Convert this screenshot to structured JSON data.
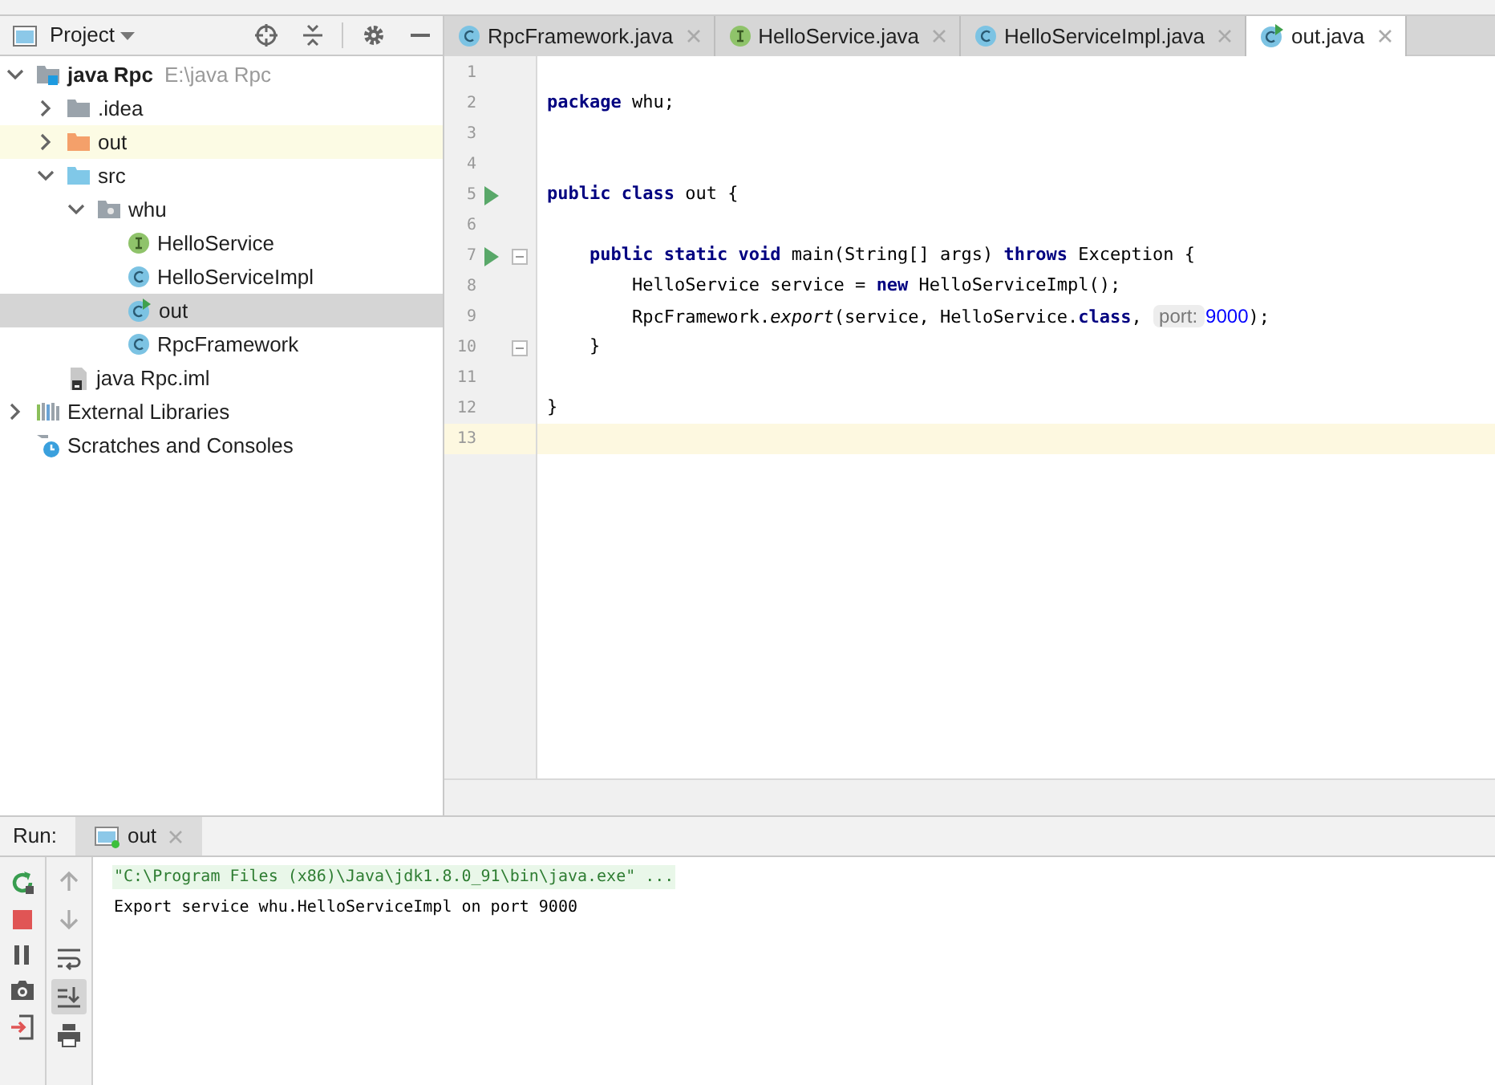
{
  "project_header": {
    "title": "Project"
  },
  "tree": [
    {
      "kind": "module",
      "label": "java Rpc",
      "path": "E:\\java Rpc",
      "expanded": true,
      "selected": false,
      "children": [
        {
          "kind": "folder",
          "label": ".idea",
          "expanded": false,
          "selected": false
        },
        {
          "kind": "excluded-folder",
          "label": "out",
          "expanded": false,
          "selected": false
        },
        {
          "kind": "source-folder",
          "label": "src",
          "expanded": true,
          "selected": false,
          "children": [
            {
              "kind": "package",
              "label": "whu",
              "expanded": true,
              "selected": false,
              "children": [
                {
                  "kind": "interface",
                  "label": "HelloService",
                  "selected": false
                },
                {
                  "kind": "class",
                  "label": "HelloServiceImpl",
                  "selected": false
                },
                {
                  "kind": "main-class",
                  "label": "out",
                  "selected": true
                },
                {
                  "kind": "class",
                  "label": "RpcFramework",
                  "selected": false
                }
              ]
            }
          ]
        },
        {
          "kind": "iml",
          "label": "java Rpc.iml",
          "selected": false
        }
      ]
    },
    {
      "kind": "libraries",
      "label": "External Libraries",
      "expanded": false,
      "selected": false
    },
    {
      "kind": "scratches",
      "label": "Scratches and Consoles",
      "selected": false
    }
  ],
  "editor_tabs": [
    {
      "kind": "class",
      "label": "RpcFramework.java",
      "selected": false
    },
    {
      "kind": "interface",
      "label": "HelloService.java",
      "selected": false
    },
    {
      "kind": "class",
      "label": "HelloServiceImpl.java",
      "selected": false
    },
    {
      "kind": "main-class",
      "label": "out.java",
      "selected": true
    }
  ],
  "code_lines": [
    {
      "number": "1",
      "current": false
    },
    {
      "number": "2",
      "current": false,
      "tokens": [
        {
          "kind": "kw",
          "t": "package"
        },
        {
          "kind": "plain",
          "t": " whu;"
        }
      ]
    },
    {
      "number": "3",
      "current": false
    },
    {
      "number": "4",
      "current": false
    },
    {
      "number": "5",
      "current": false,
      "run": true,
      "tokens": [
        {
          "kind": "kw",
          "t": "public class"
        },
        {
          "kind": "plain",
          "t": " out {"
        }
      ]
    },
    {
      "number": "6",
      "current": false
    },
    {
      "number": "7",
      "current": false,
      "run": true,
      "fold": true,
      "tokens": [
        {
          "kind": "kw",
          "t": "    public static void"
        },
        {
          "kind": "plain",
          "t": " main(String[] args) "
        },
        {
          "kind": "kw",
          "t": "throws"
        },
        {
          "kind": "plain",
          "t": " Exception {"
        }
      ]
    },
    {
      "number": "8",
      "current": false,
      "tokens": [
        {
          "kind": "plain",
          "t": "        HelloService service = "
        },
        {
          "kind": "kw",
          "t": "new"
        },
        {
          "kind": "plain",
          "t": " HelloServiceImpl();"
        }
      ]
    },
    {
      "number": "9",
      "current": false,
      "tokens": [
        {
          "kind": "plain",
          "t": "        RpcFramework."
        },
        {
          "kind": "italic",
          "t": "export"
        },
        {
          "kind": "plain",
          "t": "(service, HelloService."
        },
        {
          "kind": "kw",
          "t": "class"
        },
        {
          "kind": "plain",
          "t": ", "
        },
        {
          "kind": "hint",
          "t": "port:"
        },
        {
          "kind": "number",
          "t": "9000"
        },
        {
          "kind": "plain",
          "t": ");"
        }
      ]
    },
    {
      "number": "10",
      "current": false,
      "fold": true,
      "tokens": [
        {
          "kind": "plain",
          "t": "    }"
        }
      ]
    },
    {
      "number": "11",
      "current": false
    },
    {
      "number": "12",
      "current": false,
      "tokens": [
        {
          "kind": "plain",
          "t": "}"
        }
      ]
    },
    {
      "number": "13",
      "current": true
    }
  ],
  "run_panel": {
    "label": "Run:",
    "tab": {
      "label": "out",
      "selected": true
    },
    "toolbar": [
      {
        "kind": "up",
        "on": false
      },
      {
        "kind": "down",
        "on": false
      },
      {
        "kind": "wrap",
        "on": false
      },
      {
        "kind": "scroll-end",
        "on": true
      },
      {
        "kind": "print",
        "on": false
      }
    ],
    "console": [
      {
        "kind": "command",
        "text": "\"C:\\Program Files (x86)\\Java\\jdk1.8.0_91\\bin\\java.exe\" ..."
      },
      {
        "kind": "output",
        "text": "Export service whu.HelloServiceImpl on port 9000"
      }
    ]
  }
}
